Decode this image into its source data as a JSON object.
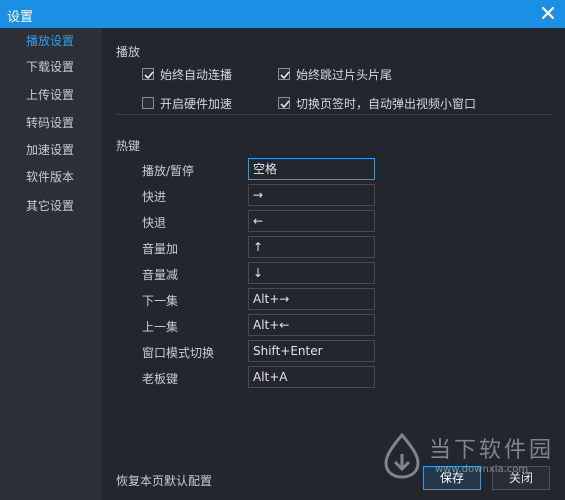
{
  "window": {
    "title": "设置"
  },
  "sidebar": {
    "items": [
      {
        "label": "播放设置",
        "active": true
      },
      {
        "label": "下载设置"
      },
      {
        "label": "上传设置"
      },
      {
        "label": "转码设置"
      },
      {
        "label": "加速设置"
      },
      {
        "label": "软件版本"
      },
      {
        "label": "其它设置"
      }
    ]
  },
  "playback": {
    "title": "播放",
    "options": [
      {
        "label": "始终自动连播",
        "checked": true
      },
      {
        "label": "始终跳过片头片尾",
        "checked": true
      },
      {
        "label": "开启硬件加速",
        "checked": false
      },
      {
        "label": "切换页签时，自动弹出视频小窗口",
        "checked": true
      }
    ]
  },
  "hotkeys": {
    "title": "热键",
    "rows": [
      {
        "label": "播放/暂停",
        "value": "空格"
      },
      {
        "label": "快进",
        "value": "→"
      },
      {
        "label": "快退",
        "value": "←"
      },
      {
        "label": "音量加",
        "value": "↑"
      },
      {
        "label": "音量减",
        "value": "↓"
      },
      {
        "label": "下一集",
        "value": "Alt+→"
      },
      {
        "label": "上一集",
        "value": "Alt+←"
      },
      {
        "label": "窗口模式切换",
        "value": "Shift+Enter"
      },
      {
        "label": "老板键",
        "value": "Alt+A"
      }
    ]
  },
  "footer": {
    "restore_label": "恢复本页默认配置",
    "save_label": "保存",
    "close_label": "关闭"
  },
  "watermark": {
    "brand": "当下软件园",
    "url": "www.downxia.com"
  },
  "colors": {
    "titlebar": "#1a8fe3",
    "accent": "#2d9cf0",
    "background": "#23272d",
    "sidebar": "#2b2f36"
  }
}
